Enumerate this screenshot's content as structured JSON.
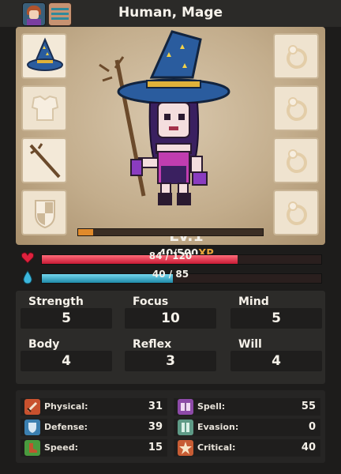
{
  "header": {
    "title": "Human, Mage",
    "tabs": [
      {
        "icon": "portrait-icon"
      },
      {
        "icon": "stats-icon"
      }
    ]
  },
  "equipment": {
    "left_slots": [
      {
        "icon": "wizard-hat-icon",
        "equipped": true
      },
      {
        "icon": "chest-armor-icon",
        "equipped": false
      },
      {
        "icon": "staff-icon",
        "equipped": true
      },
      {
        "icon": "shield-icon",
        "equipped": false
      }
    ],
    "right_slots": [
      {
        "icon": "ring-icon",
        "equipped": false
      },
      {
        "icon": "ring-icon",
        "equipped": false
      },
      {
        "icon": "ring-icon",
        "equipped": false
      },
      {
        "icon": "ring-icon",
        "equipped": false
      }
    ]
  },
  "character": {
    "level": "Lv.1",
    "xp_value": "40/500",
    "xp_suffix": "XP",
    "xp_fraction": 0.08
  },
  "vitals": {
    "hp_text": "84 / 120",
    "hp_fraction": 0.7,
    "mp_text": "40 / 85",
    "mp_fraction": 0.47,
    "hp_color": "#e0213d",
    "mp_color": "#2ea6c6"
  },
  "attributes": [
    {
      "label": "Strength",
      "value": "5"
    },
    {
      "label": "Focus",
      "value": "10"
    },
    {
      "label": "Mind",
      "value": "5"
    },
    {
      "label": "Body",
      "value": "4"
    },
    {
      "label": "Reflex",
      "value": "3"
    },
    {
      "label": "Will",
      "value": "4"
    }
  ],
  "combat_stats": [
    {
      "label": "Physical:",
      "value": "31",
      "icon": "sword-icon",
      "color": "#c8512e"
    },
    {
      "label": "Spell:",
      "value": "55",
      "icon": "spellbook-icon",
      "color": "#8d4aa8"
    },
    {
      "label": "Defense:",
      "value": "39",
      "icon": "defense-shield-icon",
      "color": "#3b7fb0"
    },
    {
      "label": "Evasion:",
      "value": "0",
      "icon": "evasion-icon",
      "color": "#5e9a86"
    },
    {
      "label": "Speed:",
      "value": "15",
      "icon": "boot-icon",
      "color": "#4a9a3e"
    },
    {
      "label": "Critical:",
      "value": "40",
      "icon": "critical-icon",
      "color": "#c75c34"
    }
  ]
}
